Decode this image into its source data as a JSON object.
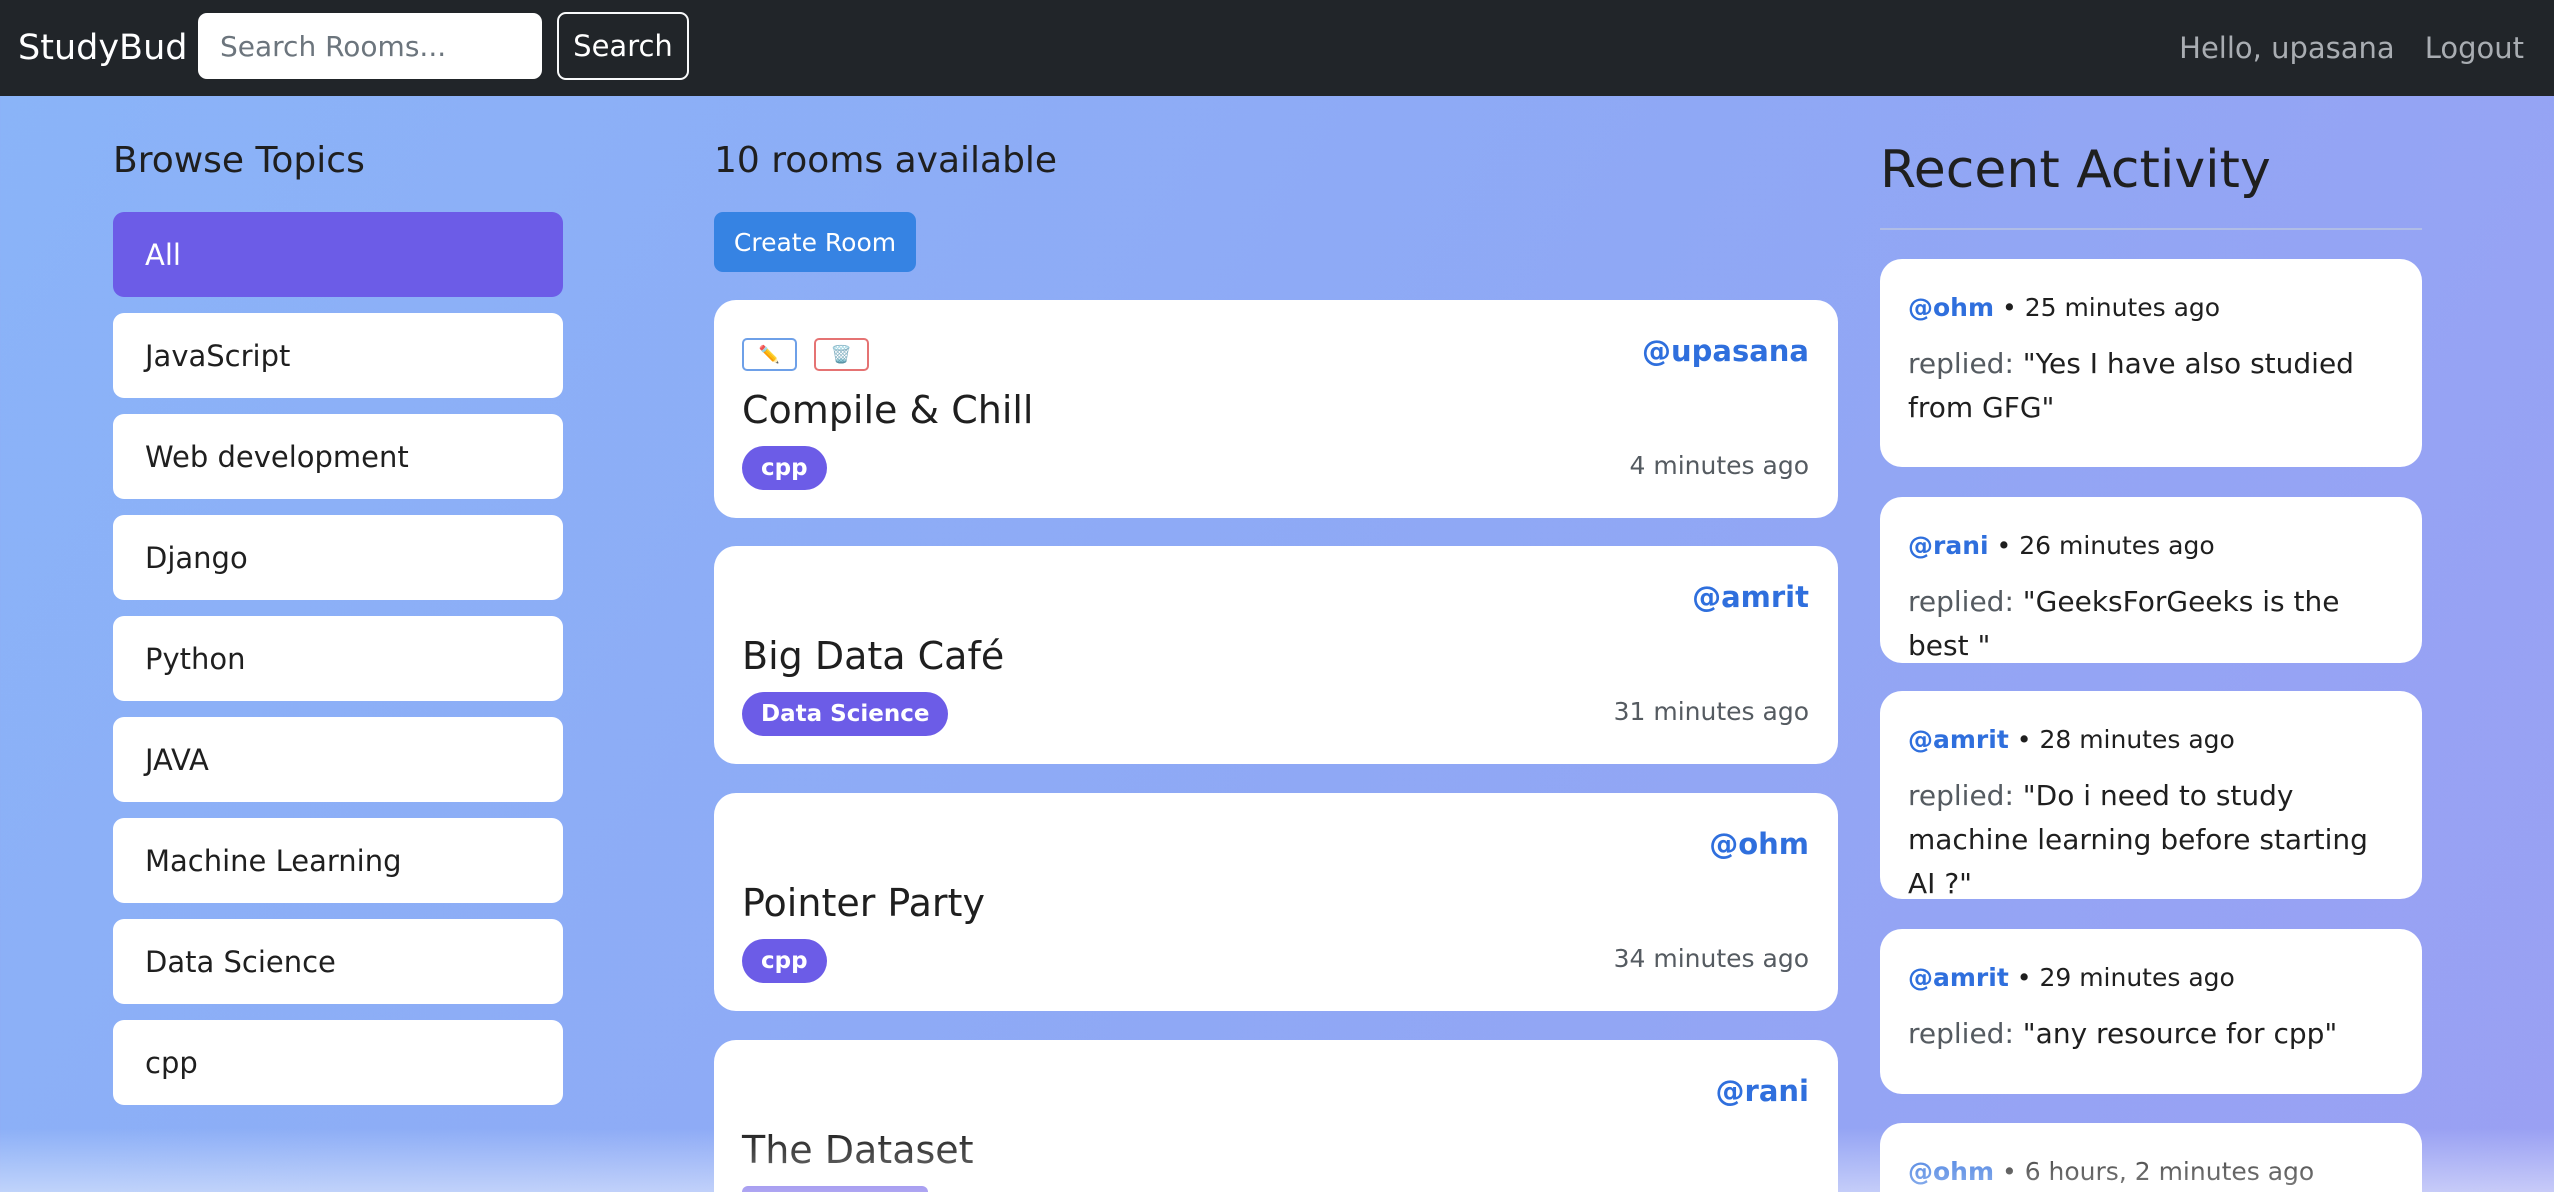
{
  "navbar": {
    "brand": "StudyBud",
    "search_placeholder": "Search Rooms...",
    "search_label": "Search",
    "greeting": "Hello, upasana",
    "logout_label": "Logout"
  },
  "topics": {
    "title": "Browse Topics",
    "items": [
      {
        "label": "All",
        "active": true
      },
      {
        "label": "JavaScript"
      },
      {
        "label": "Web development"
      },
      {
        "label": "Django"
      },
      {
        "label": "Python"
      },
      {
        "label": "JAVA"
      },
      {
        "label": "Machine Learning"
      },
      {
        "label": "Data Science"
      },
      {
        "label": "cpp"
      }
    ]
  },
  "feed": {
    "count_text": "10 rooms available",
    "create_label": "Create Room",
    "edit_icon": "✏️",
    "delete_icon": "🗑️",
    "rooms": [
      {
        "user": "@upasana",
        "title": "Compile & Chill",
        "topic": "cpp",
        "time": "4 minutes ago",
        "editable": true
      },
      {
        "user": "@amrit",
        "title": "Big Data Café",
        "topic": "Data Science",
        "time": "31 minutes ago"
      },
      {
        "user": "@ohm",
        "title": "Pointer Party",
        "topic": "cpp",
        "time": "34 minutes ago"
      },
      {
        "user": "@rani",
        "title": "The Dataset",
        "topic": "",
        "time": ""
      }
    ]
  },
  "activity": {
    "title": "Recent Activity",
    "items": [
      {
        "user": "@ohm",
        "time": "25 minutes ago",
        "label": "replied:",
        "message": "\"Yes I have also studied from GFG\""
      },
      {
        "user": "@rani",
        "time": "26 minutes ago",
        "label": "replied:",
        "message": "\"GeeksForGeeks is the best \""
      },
      {
        "user": "@amrit",
        "time": "28 minutes ago",
        "label": "replied:",
        "message": "\"Do i need to study machine learning before starting AI ?\""
      },
      {
        "user": "@amrit",
        "time": "29 minutes ago",
        "label": "replied:",
        "message": "\"any resource for cpp\""
      },
      {
        "user": "@ohm",
        "time": "6 hours, 2 minutes ago",
        "label": "",
        "message": ""
      }
    ]
  }
}
